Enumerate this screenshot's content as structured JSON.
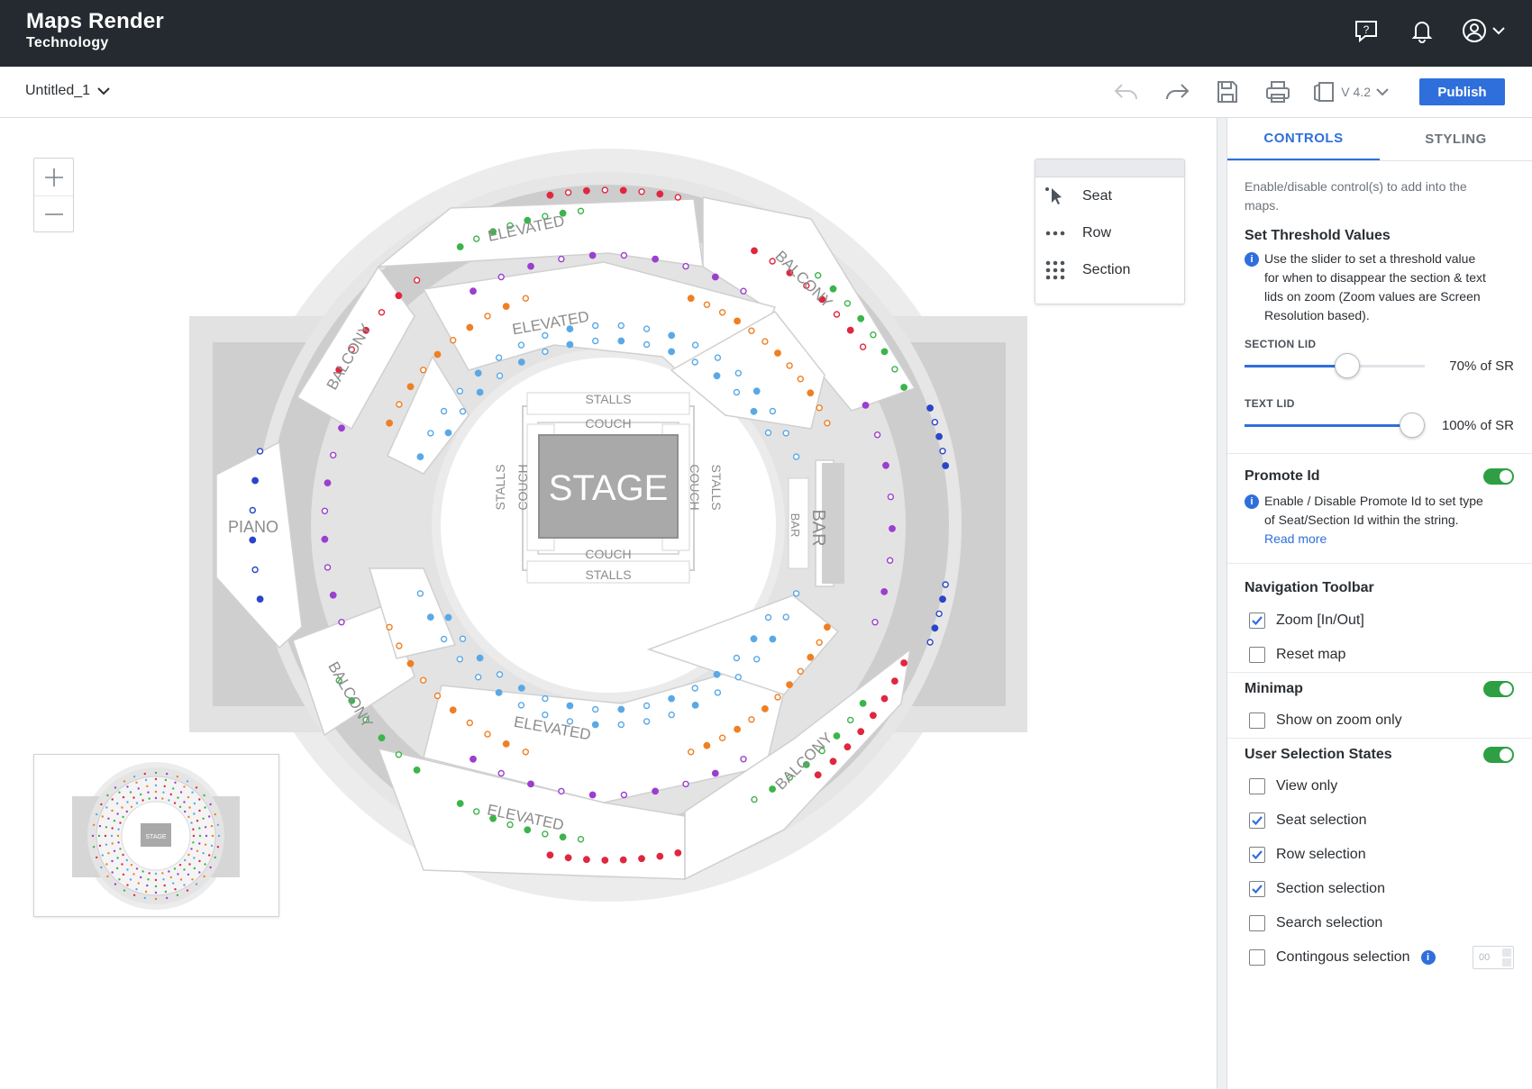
{
  "header": {
    "brand_name": "Maps Render",
    "brand_sub": "Technology",
    "help_icon": "help-bubble-icon",
    "notification_icon": "bell-icon",
    "user_icon": "user-circle-icon"
  },
  "toolbar": {
    "doc_title": "Untitled_1",
    "version": "V 4.2",
    "publish_label": "Publish"
  },
  "map": {
    "stage": "STAGE",
    "couch": "COUCH",
    "stalls": "STALLS",
    "elevated": "ELEVATED",
    "balcony": "BALCONY",
    "piano": "PIANO",
    "bar": "BAR"
  },
  "select_modes": [
    {
      "icon": "cursor-icon",
      "label": "Seat"
    },
    {
      "icon": "row-dots-icon",
      "label": "Row"
    },
    {
      "icon": "grid-dots-icon",
      "label": "Section"
    }
  ],
  "panel": {
    "tabs": [
      "CONTROLS",
      "STYLING"
    ],
    "intro": "Enable/disable control(s) to add into the maps.",
    "threshold": {
      "title": "Set Threshold Values",
      "info": "Use the slider to set a threshold value for when to disappear the section & text lids on zoom (Zoom values are Screen Resolution based).",
      "section_lid_label": "SECTION LID",
      "section_lid_value": "70% of SR",
      "section_lid_fraction": 0.57,
      "text_lid_label": "TEXT LID",
      "text_lid_value": "100% of SR",
      "text_lid_fraction": 0.93
    },
    "promote": {
      "title": "Promote Id",
      "info": "Enable / Disable Promote Id to set type of Seat/Section Id within the string.",
      "read_more": "Read more",
      "enabled": true
    },
    "navigation": {
      "title": "Navigation Toolbar",
      "items": [
        {
          "label": "Zoom [In/Out]",
          "checked": true
        },
        {
          "label": "Reset map",
          "checked": false
        }
      ]
    },
    "minimap": {
      "title": "Minimap",
      "enabled": true,
      "items": [
        {
          "label": "Show on zoom only",
          "checked": false
        }
      ]
    },
    "selection": {
      "title": "User Selection States",
      "enabled": true,
      "items": [
        {
          "label": "View only",
          "checked": false
        },
        {
          "label": "Seat selection",
          "checked": true
        },
        {
          "label": "Row selection",
          "checked": true
        },
        {
          "label": "Section selection",
          "checked": true
        },
        {
          "label": "Search selection",
          "checked": false
        },
        {
          "label": "Contingous selection",
          "checked": false
        }
      ],
      "contiguous_placeholder": "00"
    }
  },
  "colors": {
    "accent": "#2f6fdb",
    "header_bg": "#242a30",
    "toggle_on": "#2ea043",
    "seat_red": "#e0273f",
    "seat_green": "#3cb44b",
    "seat_blue": "#2b45c9",
    "seat_light_blue": "#5aa9e6",
    "seat_orange": "#f07f23",
    "seat_purple": "#9b3fcf"
  }
}
